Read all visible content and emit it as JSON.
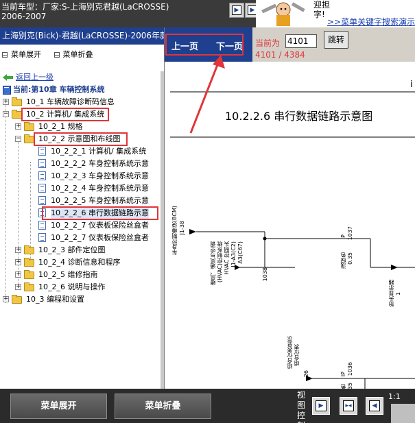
{
  "header": {
    "vehicle_line1": "当前车型：厂家:S-上海别克君越(LaCROSSE)",
    "vehicle_line2": "2006-2007",
    "promo_text_line1": "迎担",
    "promo_text_line2": "字!",
    "promo_link": ">>菜单关键字搜索演示"
  },
  "left_panel": {
    "title": "上海别克(Bick)-君越(LaCROSSE)-2006年款",
    "expand_all": "菜单展开",
    "collapse_all": "菜单折叠",
    "back_link": "返回上一级",
    "current_chapter": "当前:第10章 车辆控制系统",
    "tree": [
      {
        "label": "10_1 车辆故障诊断码信息",
        "level": 0,
        "type": "folder",
        "expander": "+"
      },
      {
        "label": "10_2 计算机/ 集成系统",
        "level": 0,
        "type": "folder-open",
        "expander": "-"
      },
      {
        "label": "10_2_1 规格",
        "level": 1,
        "type": "folder",
        "expander": "+"
      },
      {
        "label": "10_2_2 示意图和布线图",
        "level": 1,
        "type": "folder-open",
        "expander": "-"
      },
      {
        "label": "10_2_2_1 计算机/ 集成系统",
        "level": 2,
        "type": "doc"
      },
      {
        "label": "10_2_2_2 车身控制系统示意",
        "level": 2,
        "type": "doc"
      },
      {
        "label": "10_2_2_3 车身控制系统示意",
        "level": 2,
        "type": "doc"
      },
      {
        "label": "10_2_2_4 车身控制系统示意",
        "level": 2,
        "type": "doc"
      },
      {
        "label": "10_2_2_5 车身控制系统示意",
        "level": 2,
        "type": "doc"
      },
      {
        "label": "10_2_2_6 串行数据链路示意",
        "level": 2,
        "type": "doc",
        "selected": true
      },
      {
        "label": "10_2_2_7 仪表板保险丝盒者",
        "level": 2,
        "type": "doc"
      },
      {
        "label": "10_2_2_7 仪表板保险丝盒者",
        "level": 2,
        "type": "doc"
      },
      {
        "label": "10_2_3 部件定位图",
        "level": 1,
        "type": "folder",
        "expander": "+"
      },
      {
        "label": "10_2_4 诊断信息和程序",
        "level": 1,
        "type": "folder",
        "expander": "+"
      },
      {
        "label": "10_2_5 维修指南",
        "level": 1,
        "type": "folder",
        "expander": "+"
      },
      {
        "label": "10_2_6 说明与操作",
        "level": 1,
        "type": "folder",
        "expander": "+"
      },
      {
        "label": "10_3 编程和设置",
        "level": 0,
        "type": "folder",
        "expander": "+"
      }
    ]
  },
  "right_panel": {
    "prev_page": "上一页",
    "next_page": "下一页",
    "current_label": "当前为",
    "page_input_value": "4101",
    "jump_button": "跳转",
    "page_count": "4101 / 4384",
    "diagram": {
      "title": "10.2.2.6 串行数据链路示意图",
      "corner_char": "i",
      "labels": {
        "bcm": "车身控制模块(BCM)",
        "bcm_pin": "J1-38",
        "hvac_1": "暖风、通风与空调",
        "hvac_2": "(HVAC)控制系统",
        "hvac_3": "HVAC 控制头",
        "hvac_4": "J1-A3(C2)",
        "hvac_5": "A3(C67)",
        "wire_1038": "1038",
        "wire1_ip": "IP",
        "wire1_num": "1037",
        "wire1_color": "浅绿色",
        "wire1_gauge": "0.35",
        "hud_1": "抬头显示器",
        "hud_2": "1",
        "cluster_1": "组合仪表显示",
        "cluster_2": "组合仪表",
        "cluster_pin": "26",
        "wire2_ip": "IP",
        "wire2_num": "1036",
        "wire2_color": "灰色",
        "wire2_gauge": "0.35"
      }
    }
  },
  "bottom_bar": {
    "expand_all": "菜单展开",
    "collapse_all": "菜单折叠",
    "view_control": "视图控制",
    "ratio": "1:1"
  },
  "colors": {
    "highlight": "#e0363a",
    "navy": "#1f3f8f",
    "dark_bar": "#2b2b2b"
  }
}
